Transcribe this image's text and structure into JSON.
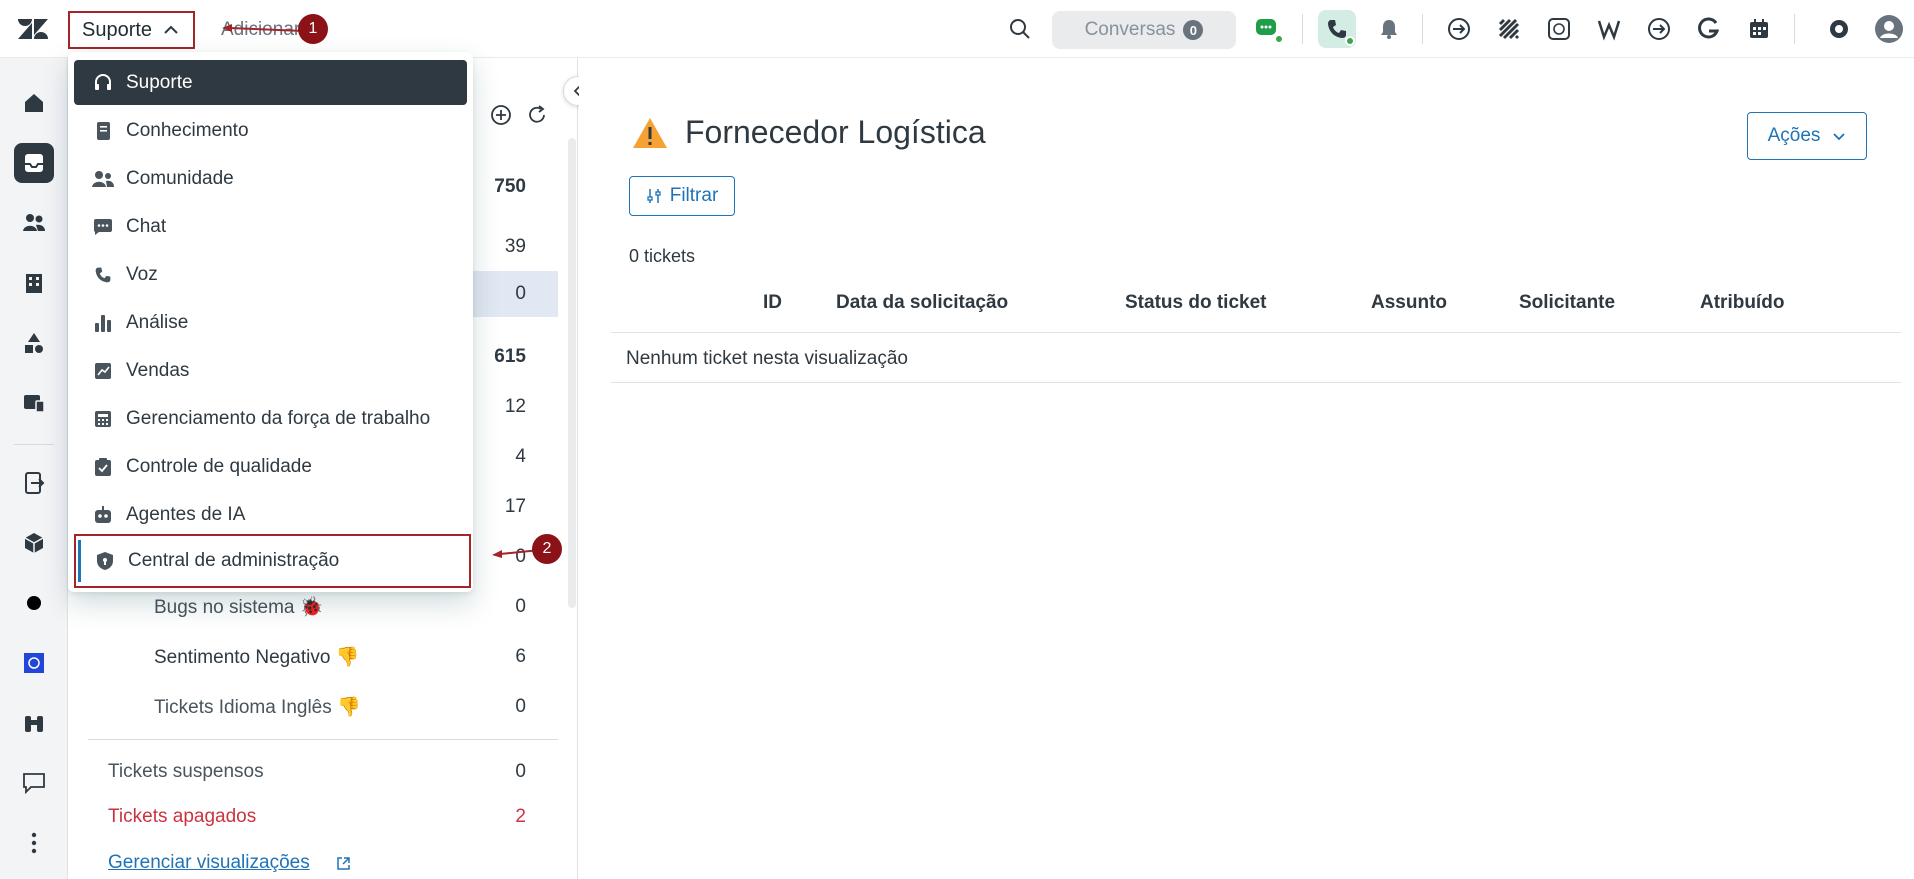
{
  "topbar": {
    "product_label": "Suporte",
    "add_label": "Adicionar",
    "conversations_label": "Conversas",
    "conversations_count": "0",
    "annotation_1": "1",
    "annotation_2": "2"
  },
  "menu": {
    "items": [
      {
        "label": "Suporte",
        "icon": "headset-icon"
      },
      {
        "label": "Conhecimento",
        "icon": "book-icon"
      },
      {
        "label": "Comunidade",
        "icon": "people-icon"
      },
      {
        "label": "Chat",
        "icon": "chat-icon"
      },
      {
        "label": "Voz",
        "icon": "phone-icon"
      },
      {
        "label": "Análise",
        "icon": "bar-chart-icon"
      },
      {
        "label": "Vendas",
        "icon": "trend-icon"
      },
      {
        "label": "Gerenciamento da força de trabalho",
        "icon": "calculator-icon"
      },
      {
        "label": "Controle de qualidade",
        "icon": "clipboard-check-icon"
      },
      {
        "label": "Agentes de IA",
        "icon": "robot-icon"
      },
      {
        "label": "Central de administração",
        "icon": "shield-icon"
      }
    ]
  },
  "views": {
    "counts_visible": [
      "750",
      "39",
      "0",
      "615",
      "12",
      "4",
      "17",
      "0"
    ],
    "rows": [
      {
        "label": "Bugs no sistema 🐞",
        "count": "0"
      },
      {
        "label": "Sentimento Negativo 👎",
        "count": "6"
      },
      {
        "label": "Tickets Idioma Inglês 👎",
        "count": "0"
      }
    ],
    "suspended_label": "Tickets suspensos",
    "suspended_count": "0",
    "deleted_label": "Tickets apagados",
    "deleted_count": "2",
    "manage_label": "Gerenciar visualizações"
  },
  "main": {
    "title": "Fornecedor Logística",
    "actions_label": "Ações",
    "filter_label": "Filtrar",
    "ticket_count": "0 tickets",
    "columns": [
      "ID",
      "Data da solicitação",
      "Status do ticket",
      "Assunto",
      "Solicitante",
      "Atribuído"
    ],
    "empty_message": "Nenhum ticket nesta visualização"
  },
  "colors": {
    "accent": "#1f73b7",
    "annotation": "#8b1216",
    "danger": "#cc3340",
    "dark": "#2f3941",
    "warning": "#f5a133"
  }
}
